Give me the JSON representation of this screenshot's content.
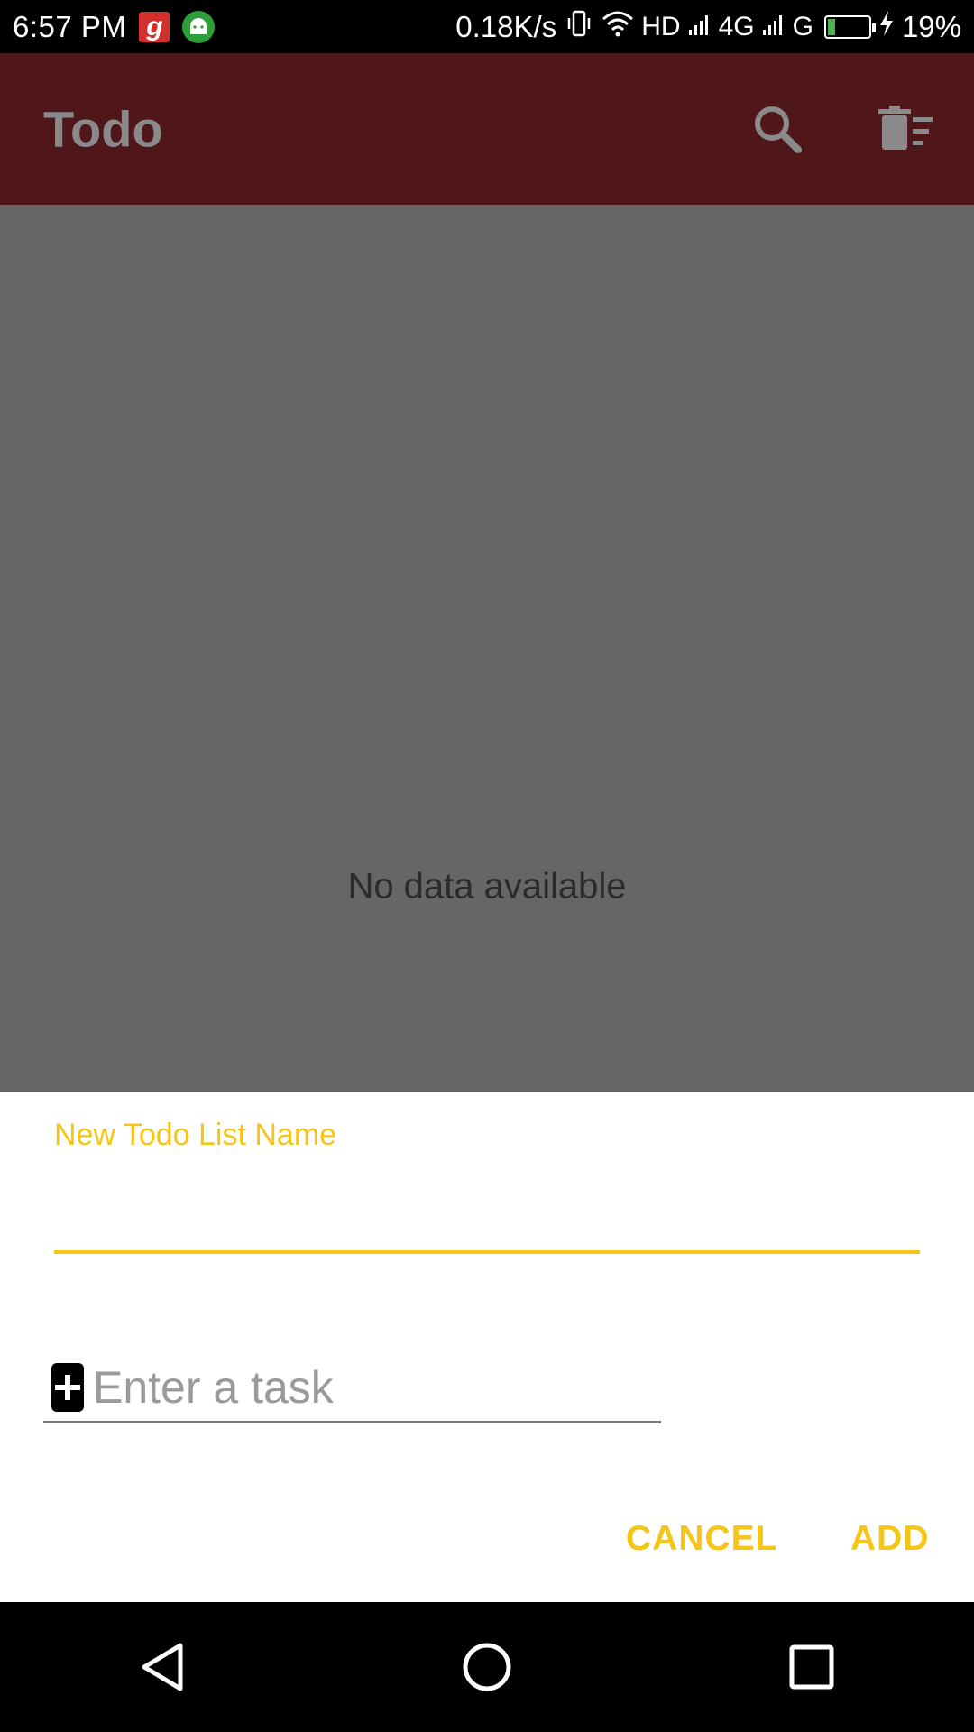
{
  "status_bar": {
    "time": "6:57 PM",
    "net_speed": "0.18K/s",
    "hd": "HD",
    "net_4g": "4G",
    "net_g": "G",
    "battery": "19%",
    "battery_level": 0.19,
    "icons": [
      "app-g-icon",
      "android-icon",
      "vibrate-icon",
      "wifi-icon",
      "signal-icon",
      "signal-icon",
      "battery-icon",
      "charging-icon"
    ]
  },
  "app_bar": {
    "title": "Todo",
    "icons": [
      "search-icon",
      "delete-sweep-icon"
    ],
    "color": "#4f1719"
  },
  "content": {
    "empty_message": "No data available",
    "background": "#666666"
  },
  "dialog": {
    "list_name_label": "New Todo List Name",
    "list_name_value": "",
    "task_placeholder": "Enter a task",
    "task_icon": "add-box-icon",
    "cancel_label": "CANCEL",
    "add_label": "ADD",
    "accent_color": "#f5c518"
  },
  "nav_bar": {
    "icons": [
      "back-icon",
      "home-icon",
      "recents-icon"
    ]
  }
}
